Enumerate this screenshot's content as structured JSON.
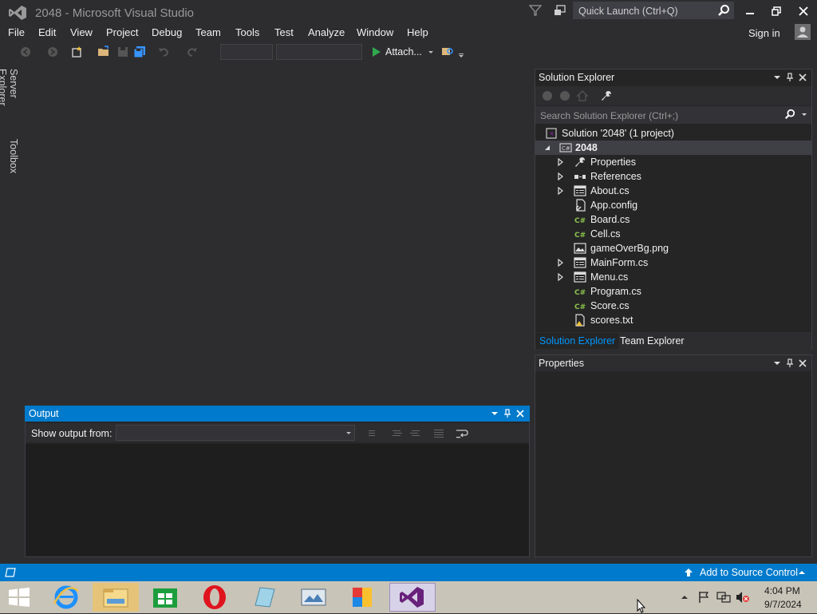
{
  "window": {
    "title": "2048 - Microsoft Visual Studio",
    "quick_launch_placeholder": "Quick Launch (Ctrl+Q)",
    "sign_in": "Sign in"
  },
  "menu": [
    "File",
    "Edit",
    "View",
    "Project",
    "Debug",
    "Team",
    "Tools",
    "Test",
    "Analyze",
    "Window",
    "Help"
  ],
  "toolbar": {
    "attach_label": "Attach..."
  },
  "side_tabs": [
    "Server Explorer",
    "Toolbox"
  ],
  "output": {
    "title": "Output",
    "show_output_from": "Show output from:",
    "selected_source": ""
  },
  "solution_explorer": {
    "title": "Solution Explorer",
    "search_placeholder": "Search Solution Explorer (Ctrl+;)",
    "solution": "Solution '2048' (1 project)",
    "project": "2048",
    "items": [
      {
        "label": "Properties",
        "icon": "wrench-icon",
        "expandable": true
      },
      {
        "label": "References",
        "icon": "references-icon",
        "expandable": true
      },
      {
        "label": "About.cs",
        "icon": "form-icon",
        "expandable": true
      },
      {
        "label": "App.config",
        "icon": "config-icon",
        "expandable": false
      },
      {
        "label": "Board.cs",
        "icon": "csharp-icon",
        "expandable": false
      },
      {
        "label": "Cell.cs",
        "icon": "csharp-icon",
        "expandable": false
      },
      {
        "label": "gameOverBg.png",
        "icon": "image-icon",
        "expandable": false
      },
      {
        "label": "MainForm.cs",
        "icon": "form-icon",
        "expandable": true
      },
      {
        "label": "Menu.cs",
        "icon": "form-icon",
        "expandable": true
      },
      {
        "label": "Program.cs",
        "icon": "csharp-icon",
        "expandable": false
      },
      {
        "label": "Score.cs",
        "icon": "csharp-icon",
        "expandable": false
      },
      {
        "label": "scores.txt",
        "icon": "text-file-warning-icon",
        "expandable": false
      }
    ],
    "tabs": [
      "Solution Explorer",
      "Team Explorer"
    ]
  },
  "properties": {
    "title": "Properties"
  },
  "status_bar": {
    "source_control": "Add to Source Control"
  },
  "taskbar": {
    "apps": [
      "internet-explorer-icon",
      "file-explorer-icon",
      "store-icon",
      "opera-icon",
      "notepad-icon",
      "remote-desktop-icon",
      "control-panel-icon",
      "visual-studio-icon"
    ],
    "time": "4:04 PM",
    "date": "9/7/2024"
  },
  "colors": {
    "accent": "#007acc",
    "background": "#2d2d30",
    "panel": "#252526",
    "purple": "#68217a"
  }
}
